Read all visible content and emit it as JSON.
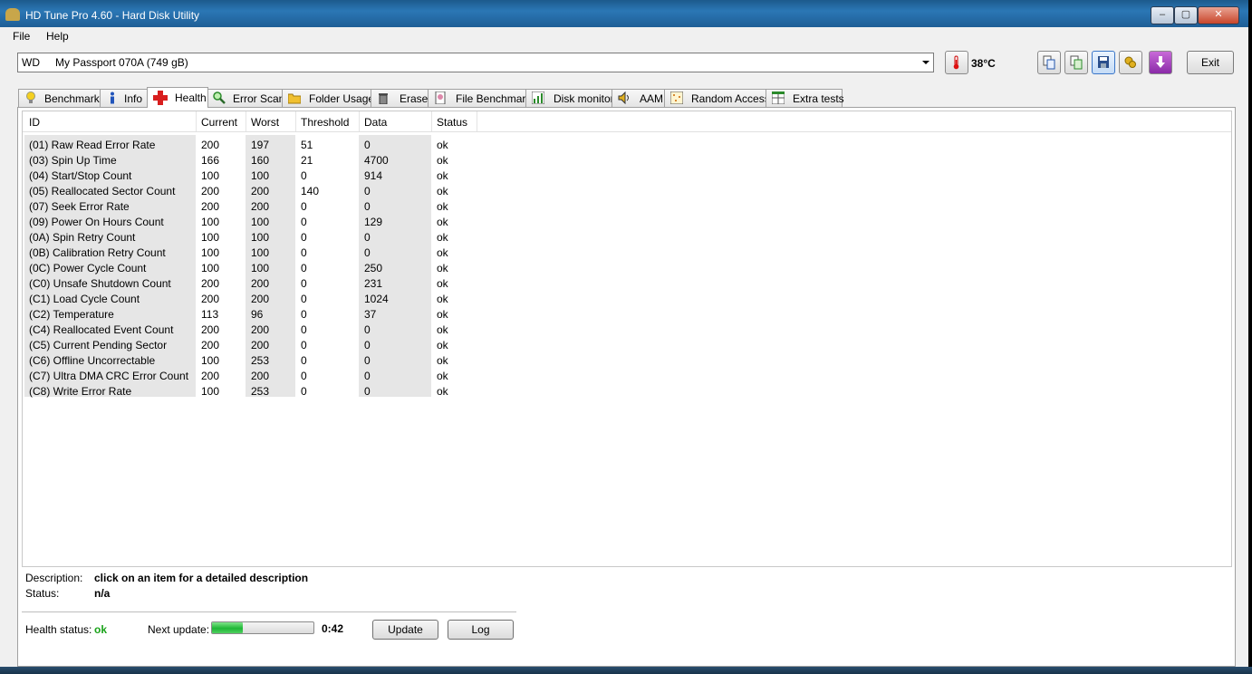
{
  "window": {
    "title": "HD Tune Pro 4.60 - Hard Disk Utility",
    "min_label": "–",
    "max_label": "▢",
    "close_label": "✕"
  },
  "menu": {
    "file": "File",
    "help": "Help"
  },
  "drive": {
    "vendor": "WD",
    "model": "My Passport 070A (749 gB)"
  },
  "temperature": "38°C",
  "toolbar": {
    "exit_label": "Exit"
  },
  "tabs": [
    "Benchmark",
    "Info",
    "Health",
    "Error Scan",
    "Folder Usage",
    "Erase",
    "File Benchmark",
    "Disk monitor",
    "AAM",
    "Random Access",
    "Extra tests"
  ],
  "table": {
    "headers": {
      "id": "ID",
      "current": "Current",
      "worst": "Worst",
      "threshold": "Threshold",
      "data": "Data",
      "status": "Status"
    },
    "rows": [
      [
        "(01) Raw Read Error Rate",
        "200",
        "197",
        "51",
        "0",
        "ok"
      ],
      [
        "(03) Spin Up Time",
        "166",
        "160",
        "21",
        "4700",
        "ok"
      ],
      [
        "(04) Start/Stop Count",
        "100",
        "100",
        "0",
        "914",
        "ok"
      ],
      [
        "(05) Reallocated Sector Count",
        "200",
        "200",
        "140",
        "0",
        "ok"
      ],
      [
        "(07) Seek Error Rate",
        "200",
        "200",
        "0",
        "0",
        "ok"
      ],
      [
        "(09) Power On Hours Count",
        "100",
        "100",
        "0",
        "129",
        "ok"
      ],
      [
        "(0A) Spin Retry Count",
        "100",
        "100",
        "0",
        "0",
        "ok"
      ],
      [
        "(0B) Calibration Retry Count",
        "100",
        "100",
        "0",
        "0",
        "ok"
      ],
      [
        "(0C) Power Cycle Count",
        "100",
        "100",
        "0",
        "250",
        "ok"
      ],
      [
        "(C0) Unsafe Shutdown Count",
        "200",
        "200",
        "0",
        "231",
        "ok"
      ],
      [
        "(C1) Load Cycle Count",
        "200",
        "200",
        "0",
        "1024",
        "ok"
      ],
      [
        "(C2) Temperature",
        "113",
        "96",
        "0",
        "37",
        "ok"
      ],
      [
        "(C4) Reallocated Event Count",
        "200",
        "200",
        "0",
        "0",
        "ok"
      ],
      [
        "(C5) Current Pending Sector",
        "200",
        "200",
        "0",
        "0",
        "ok"
      ],
      [
        "(C6) Offline Uncorrectable",
        "100",
        "253",
        "0",
        "0",
        "ok"
      ],
      [
        "(C7) Ultra DMA CRC Error Count",
        "200",
        "200",
        "0",
        "0",
        "ok"
      ],
      [
        "(C8) Write Error Rate",
        "100",
        "253",
        "0",
        "0",
        "ok"
      ]
    ]
  },
  "footer": {
    "description_label": "Description:",
    "description_value": "click on an item for a detailed description",
    "status_label": "Status:",
    "status_value": "n/a",
    "health_label": "Health status:",
    "health_value": "ok",
    "next_update_label": "Next update:",
    "next_update_time": "0:42",
    "next_update_progress": 0.3,
    "update_button": "Update",
    "log_button": "Log"
  },
  "colors": {
    "health_ok": "#1aa31a",
    "progress_green": "#1fb636",
    "title_blue": "#2b77b5"
  }
}
